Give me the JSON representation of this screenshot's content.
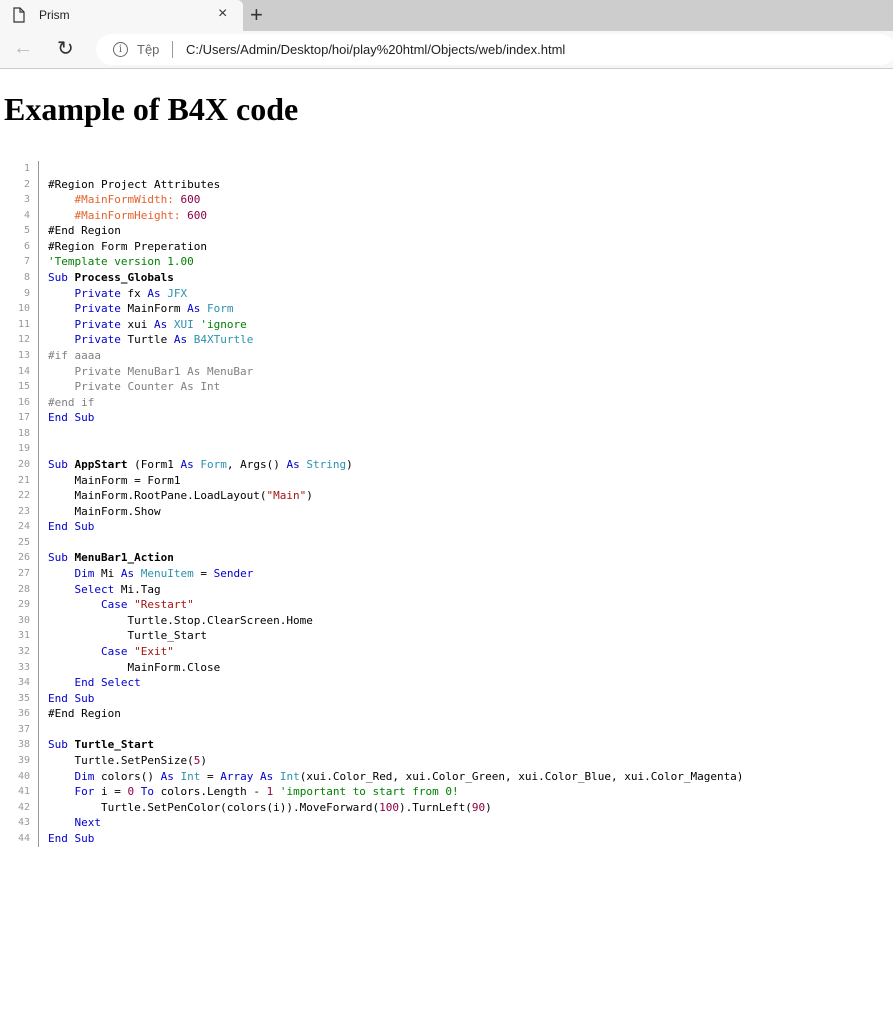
{
  "browser": {
    "tab_title": "Prism",
    "close": "×",
    "new_tab": "+",
    "back": "←",
    "reload": "↻",
    "info": "i",
    "security_label": "Tệp",
    "url": "C:/Users/Admin/Desktop/hoi/play%20html/Objects/web/index.html"
  },
  "page": {
    "heading": "Example of B4X code"
  },
  "colors": {
    "keyword": "#0000cc",
    "type": "#2b91af",
    "string": "#a31515",
    "number": "#8b0043",
    "comment": "#008000",
    "attribute": "#e5622e",
    "disabled": "#808080"
  },
  "code": {
    "lines": [
      [],
      [
        [
          "p",
          "#Region Project Attributes"
        ]
      ],
      [
        [
          "p",
          "    "
        ],
        [
          "a",
          "#MainFormWidth: "
        ],
        [
          "n",
          "600"
        ]
      ],
      [
        [
          "p",
          "    "
        ],
        [
          "a",
          "#MainFormHeight: "
        ],
        [
          "n",
          "600"
        ]
      ],
      [
        [
          "p",
          "#End Region"
        ]
      ],
      [
        [
          "p",
          "#Region Form Preperation"
        ]
      ],
      [
        [
          "c",
          "'Template version 1.00"
        ]
      ],
      [
        [
          "k",
          "Sub "
        ],
        [
          "b",
          "Process_Globals"
        ]
      ],
      [
        [
          "p",
          "    "
        ],
        [
          "k",
          "Private"
        ],
        [
          "p",
          " fx "
        ],
        [
          "k",
          "As"
        ],
        [
          "t",
          " JFX"
        ]
      ],
      [
        [
          "p",
          "    "
        ],
        [
          "k",
          "Private"
        ],
        [
          "p",
          " MainForm "
        ],
        [
          "k",
          "As"
        ],
        [
          "t",
          " Form"
        ]
      ],
      [
        [
          "p",
          "    "
        ],
        [
          "k",
          "Private"
        ],
        [
          "p",
          " xui "
        ],
        [
          "k",
          "As"
        ],
        [
          "t",
          " XUI"
        ],
        [
          "c",
          " 'ignore"
        ]
      ],
      [
        [
          "p",
          "    "
        ],
        [
          "k",
          "Private"
        ],
        [
          "p",
          " Turtle "
        ],
        [
          "k",
          "As"
        ],
        [
          "t",
          " B4XTurtle"
        ]
      ],
      [
        [
          "d",
          "#if aaaa"
        ]
      ],
      [
        [
          "d",
          "    Private MenuBar1 As MenuBar"
        ]
      ],
      [
        [
          "d",
          "    Private Counter As Int"
        ]
      ],
      [
        [
          "d",
          "#end if"
        ]
      ],
      [
        [
          "k",
          "End Sub"
        ]
      ],
      [],
      [],
      [
        [
          "k",
          "Sub "
        ],
        [
          "b",
          "AppStart"
        ],
        [
          "p",
          " (Form1 "
        ],
        [
          "k",
          "As"
        ],
        [
          "t",
          " Form"
        ],
        [
          "p",
          ", Args() "
        ],
        [
          "k",
          "As"
        ],
        [
          "t",
          " String"
        ],
        [
          "p",
          ")"
        ]
      ],
      [
        [
          "p",
          "    MainForm = Form1"
        ]
      ],
      [
        [
          "p",
          "    MainForm.RootPane.LoadLayout("
        ],
        [
          "s",
          "\"Main\""
        ],
        [
          "p",
          ")"
        ]
      ],
      [
        [
          "p",
          "    MainForm.Show"
        ]
      ],
      [
        [
          "k",
          "End Sub"
        ]
      ],
      [],
      [
        [
          "k",
          "Sub "
        ],
        [
          "b",
          "MenuBar1_Action"
        ]
      ],
      [
        [
          "p",
          "    "
        ],
        [
          "k",
          "Dim"
        ],
        [
          "p",
          " Mi "
        ],
        [
          "k",
          "As"
        ],
        [
          "t",
          " MenuItem"
        ],
        [
          "p",
          " = "
        ],
        [
          "k",
          "Sender"
        ]
      ],
      [
        [
          "p",
          "    "
        ],
        [
          "k",
          "Select"
        ],
        [
          "p",
          " Mi.Tag"
        ]
      ],
      [
        [
          "p",
          "        "
        ],
        [
          "k",
          "Case "
        ],
        [
          "s",
          "\"Restart\""
        ]
      ],
      [
        [
          "p",
          "            Turtle.Stop.ClearScreen.Home"
        ]
      ],
      [
        [
          "p",
          "            Turtle_Start"
        ]
      ],
      [
        [
          "p",
          "        "
        ],
        [
          "k",
          "Case "
        ],
        [
          "s",
          "\"Exit\""
        ]
      ],
      [
        [
          "p",
          "            MainForm.Close"
        ]
      ],
      [
        [
          "p",
          "    "
        ],
        [
          "k",
          "End Select"
        ]
      ],
      [
        [
          "k",
          "End Sub"
        ]
      ],
      [
        [
          "p",
          "#End Region"
        ]
      ],
      [],
      [
        [
          "k",
          "Sub "
        ],
        [
          "b",
          "Turtle_Start"
        ]
      ],
      [
        [
          "p",
          "    Turtle.SetPenSize("
        ],
        [
          "n",
          "5"
        ],
        [
          "p",
          ")"
        ]
      ],
      [
        [
          "p",
          "    "
        ],
        [
          "k",
          "Dim"
        ],
        [
          "p",
          " colors() "
        ],
        [
          "k",
          "As"
        ],
        [
          "t",
          " Int"
        ],
        [
          "p",
          " = "
        ],
        [
          "k",
          "Array As"
        ],
        [
          "t",
          " Int"
        ],
        [
          "p",
          "(xui.Color_Red, xui.Color_Green, xui.Color_Blue, xui.Color_Magenta)"
        ]
      ],
      [
        [
          "p",
          "    "
        ],
        [
          "k",
          "For"
        ],
        [
          "p",
          " i = "
        ],
        [
          "n",
          "0"
        ],
        [
          "k",
          " To"
        ],
        [
          "p",
          " colors.Length - "
        ],
        [
          "n",
          "1"
        ],
        [
          "c",
          " 'important to start from 0!"
        ]
      ],
      [
        [
          "p",
          "        Turtle.SetPenColor(colors(i)).MoveForward("
        ],
        [
          "n",
          "100"
        ],
        [
          "p",
          ").TurnLeft("
        ],
        [
          "n",
          "90"
        ],
        [
          "p",
          ")"
        ]
      ],
      [
        [
          "p",
          "    "
        ],
        [
          "k",
          "Next"
        ]
      ],
      [
        [
          "k",
          "End Sub"
        ]
      ]
    ]
  }
}
